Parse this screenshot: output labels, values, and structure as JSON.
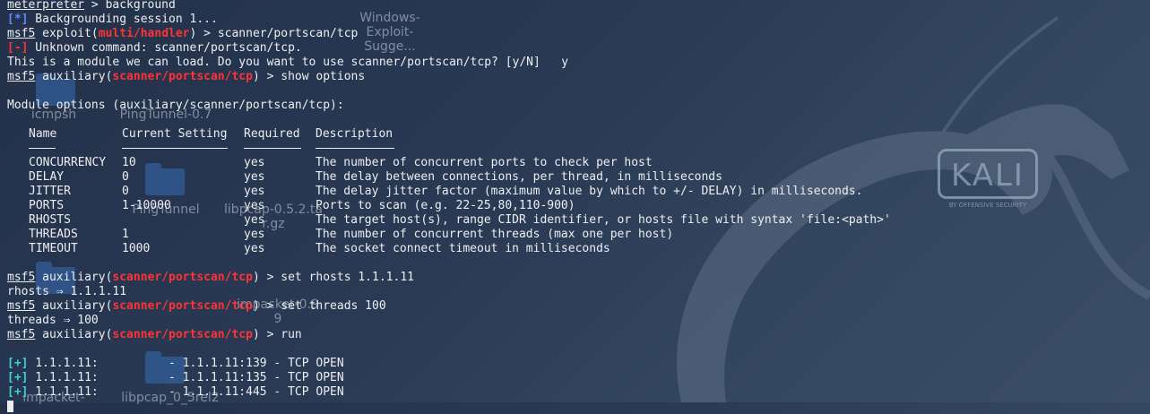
{
  "desktop": {
    "icons": [
      {
        "name": "windows-exploit-icon",
        "label": "Windows-",
        "label2": "Exploit-Sugge..."
      },
      {
        "name": "icmpsh-icon",
        "label": "icmpsh"
      },
      {
        "name": "pingtunnel07-icon",
        "label": "PingTunnel-0.7"
      },
      {
        "name": "pingtunnel-icon",
        "label": "PingTunnel"
      },
      {
        "name": "libpcap-archive-icon",
        "label": "libpcap-0.5.2.ta",
        "label2": "r.gz"
      },
      {
        "name": "libpcap-folder-icon",
        "label": "libpcap_0_5rel2"
      },
      {
        "name": "impacket-icon",
        "label": "impacket-0.9",
        "label2": "9"
      },
      {
        "name": "impacket-folder-icon",
        "label": "impacket-"
      }
    ],
    "kali_logo": "KALI",
    "kali_tag": "BY OFFENSIVE SECURITY"
  },
  "terminal": {
    "l1_prompt": "meterpreter",
    "l1_cmd": " > background",
    "l2_tag": "[*]",
    "l2_text": " Backgrounding session 1...",
    "l3_msf": "msf5",
    "l3_mid": " exploit(",
    "l3_mod": "multi/handler",
    "l3_cmd": ") > scanner/portscan/tcp",
    "l4_tag": "[-]",
    "l4_text": " Unknown command: scanner/portscan/tcp.",
    "l5_text": "This is a module we can load. Do you want to use scanner/portscan/tcp? [y/N]   y",
    "l6_msf": "msf5",
    "l6_mid": " auxiliary(",
    "l6_mod": "scanner/portscan/tcp",
    "l6_cmd": ") > show options",
    "module_header": "Module options (auxiliary/scanner/portscan/tcp):",
    "columns": {
      "name": "Name",
      "setting": "Current Setting",
      "required": "Required",
      "description": "Description"
    },
    "options": [
      {
        "name": "CONCURRENCY",
        "setting": "10",
        "required": "yes",
        "description": "The number of concurrent ports to check per host"
      },
      {
        "name": "DELAY",
        "setting": "0",
        "required": "yes",
        "description": "The delay between connections, per thread, in milliseconds"
      },
      {
        "name": "JITTER",
        "setting": "0",
        "required": "yes",
        "description": "The delay jitter factor (maximum value by which to +/- DELAY) in milliseconds."
      },
      {
        "name": "PORTS",
        "setting": "1-10000",
        "required": "yes",
        "description": "Ports to scan (e.g. 22-25,80,110-900)"
      },
      {
        "name": "RHOSTS",
        "setting": "",
        "required": "yes",
        "description": "The target host(s), range CIDR identifier, or hosts file with syntax 'file:<path>'"
      },
      {
        "name": "THREADS",
        "setting": "1",
        "required": "yes",
        "description": "The number of concurrent threads (max one per host)"
      },
      {
        "name": "TIMEOUT",
        "setting": "1000",
        "required": "yes",
        "description": "The socket connect timeout in milliseconds"
      }
    ],
    "set1_msf": "msf5",
    "set1_mid": " auxiliary(",
    "set1_mod": "scanner/portscan/tcp",
    "set1_cmd": ") > set rhosts 1.1.1.11",
    "set1_out": "rhosts ⇒ 1.1.1.11",
    "set2_msf": "msf5",
    "set2_mid": " auxiliary(",
    "set2_mod": "scanner/portscan/tcp",
    "set2_cmd": ") > set threads 100",
    "set2_out": "threads ⇒ 100",
    "run_msf": "msf5",
    "run_mid": " auxiliary(",
    "run_mod": "scanner/portscan/tcp",
    "run_cmd": ") > run",
    "results": [
      {
        "tag": "[+]",
        "text": " 1.1.1.11:          - 1.1.1.11:139 - TCP OPEN"
      },
      {
        "tag": "[+]",
        "text": " 1.1.1.11:          - 1.1.1.11:135 - TCP OPEN"
      },
      {
        "tag": "[+]",
        "text": " 1.1.1.11:          - 1.1.1.11:445 - TCP OPEN"
      }
    ]
  }
}
